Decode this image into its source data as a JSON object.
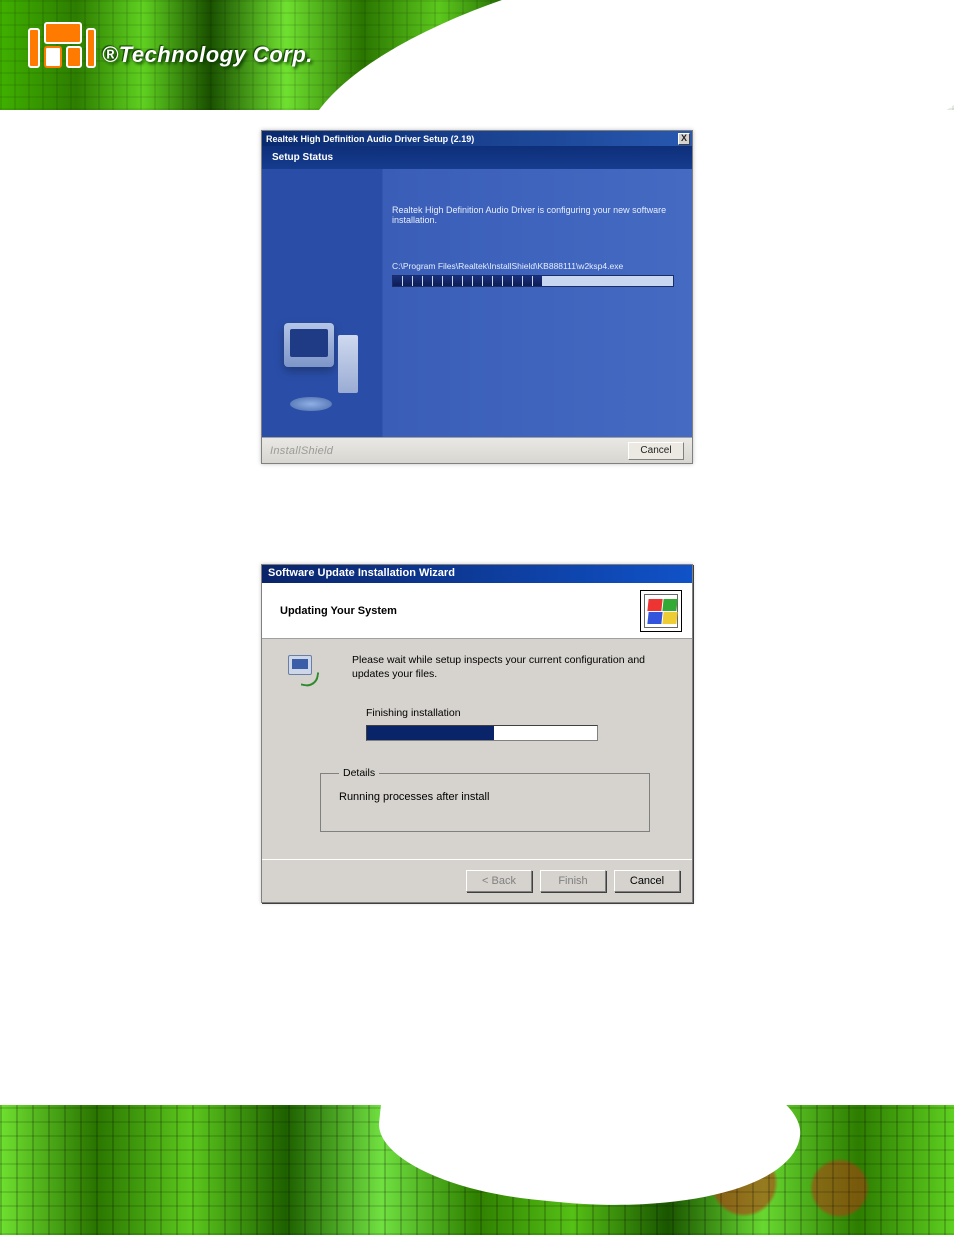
{
  "brand": {
    "logo_alt": "iEi",
    "brand_text": "®Technology Corp."
  },
  "dialog1": {
    "title": "Realtek High Definition Audio Driver Setup (2.19)",
    "close_x": "X",
    "sub_heading": "Setup Status",
    "status_text": "Realtek High Definition Audio Driver is configuring your new software installation.",
    "path_text": "C:\\Program Files\\Realtek\\InstallShield\\KB888111\\w2ksp4.exe",
    "progress_segments": 15,
    "progress_filled": 15,
    "brand_label": "InstallShield",
    "cancel_label": "Cancel"
  },
  "dialog2": {
    "title": "Software Update Installation Wizard",
    "heading": "Updating Your System",
    "description": "Please wait while setup inspects your current configuration and updates your files.",
    "stage_text": "Finishing installation",
    "progress_percent": 55,
    "details_legend": "Details",
    "details_text": "Running processes after install",
    "buttons": {
      "back": "< Back",
      "finish": "Finish",
      "cancel": "Cancel"
    }
  }
}
